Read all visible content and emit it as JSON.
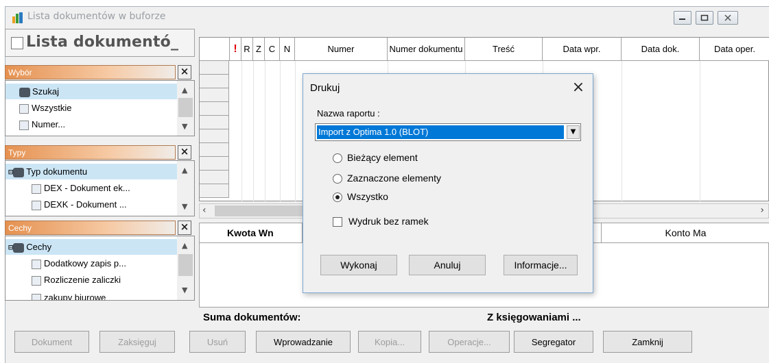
{
  "window": {
    "title": "Lista dokumentów w buforze"
  },
  "panel": {
    "title": "Lista dokumentó_"
  },
  "sections": [
    {
      "header": "Wybór",
      "items": [
        "Szukaj",
        "Wszystkie",
        "Numer..."
      ]
    },
    {
      "header": "Typy",
      "items": [
        "Typ dokumentu",
        "DEX - Dokument ek...",
        "DEXK - Dokument ..."
      ]
    },
    {
      "header": "Cechy",
      "items": [
        "Cechy",
        "Dodatkowy zapis p...",
        "Rozliczenie zaliczki",
        "zakupy biurowe"
      ]
    }
  ],
  "grid": {
    "columns": [
      "!",
      "R",
      "Z",
      "C",
      "N",
      "Numer",
      "Numer dokumentu",
      "Treść",
      "Data wpr.",
      "Data dok.",
      "Data oper."
    ]
  },
  "bottom_grid": {
    "col_wn": "Kwota Wn",
    "col_ma": "Konto Ma"
  },
  "summary": {
    "left": "Suma dokumentów:",
    "right": "Z księgowaniami ..."
  },
  "buttons": {
    "dokument": "Dokument",
    "zaksieguj": "Zaksięguj",
    "usun": "Usuń",
    "wprowadzanie": "Wprowadzanie",
    "kopia": "Kopia...",
    "operacje": "Operacje...",
    "segregator": "Segregator",
    "zamknij": "Zamknij"
  },
  "dialog": {
    "title": "Drukuj",
    "report_label": "Nazwa raportu :",
    "report_value": "Import z Optima 1.0 (BLOT)",
    "options": [
      "Bieżący element",
      "Zaznaczone elementy",
      "Wszystko"
    ],
    "selected_option": "Wszystko",
    "checkbox_label": "Wydruk bez ramek",
    "checkbox_checked": false,
    "btn_execute": "Wykonaj",
    "btn_cancel": "Anuluj",
    "btn_info": "Informacje..."
  },
  "colors": {
    "section_header": "#e59150",
    "selection": "#cbe5f5",
    "combo_highlight": "#0078d7",
    "alert_mark": "#e00000"
  }
}
